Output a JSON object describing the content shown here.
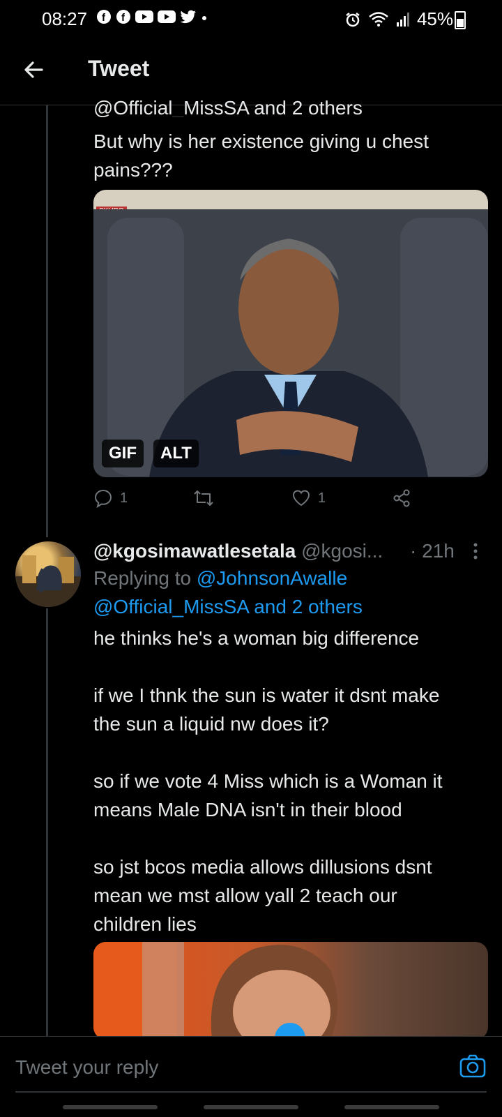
{
  "status_bar": {
    "time": "08:27",
    "battery": "45%",
    "notification_icons": [
      "facebook-icon",
      "facebook-icon",
      "youtube-icon",
      "youtube-icon",
      "twitter-icon",
      "dot-icon"
    ],
    "system_icons": [
      "alarm-icon",
      "wifi-icon",
      "signal-icon",
      "battery-icon"
    ]
  },
  "header": {
    "title": "Tweet"
  },
  "tweet1": {
    "reply_to_partial": "@Official_MissSA and 2 others",
    "text_lines": [
      "But why is her existence giving u chest",
      "pains???"
    ],
    "media": {
      "badges": [
        "GIF",
        "ALT"
      ],
      "watermark": "SKURO"
    },
    "actions": {
      "replies": "1",
      "likes": "1"
    }
  },
  "tweet2": {
    "display_name": "@kgosimawatlesetala",
    "handle": "@kgosi...",
    "time": "· 21h",
    "replying_label": "Replying to",
    "reply_to": "@JohnsonAwalle",
    "reply_to_2": "@Official_MissSA and 2 others",
    "text_lines": [
      "he thinks he's a woman big difference",
      "",
      "if we I thnk the sun is water it dsnt make",
      "the sun a liquid nw does it?",
      "",
      "so if we vote 4 Miss which is a Woman it",
      "means Male DNA isn't in their blood",
      "",
      "so jst bcos media allows dillusions dsnt",
      "mean we mst allow yall 2 teach our",
      "children lies"
    ]
  },
  "reply_bar": {
    "placeholder": "Tweet your reply"
  },
  "colors": {
    "accent": "#1d9bf0",
    "muted": "#71767b",
    "text": "#e7e9ea",
    "background": "#000000"
  }
}
